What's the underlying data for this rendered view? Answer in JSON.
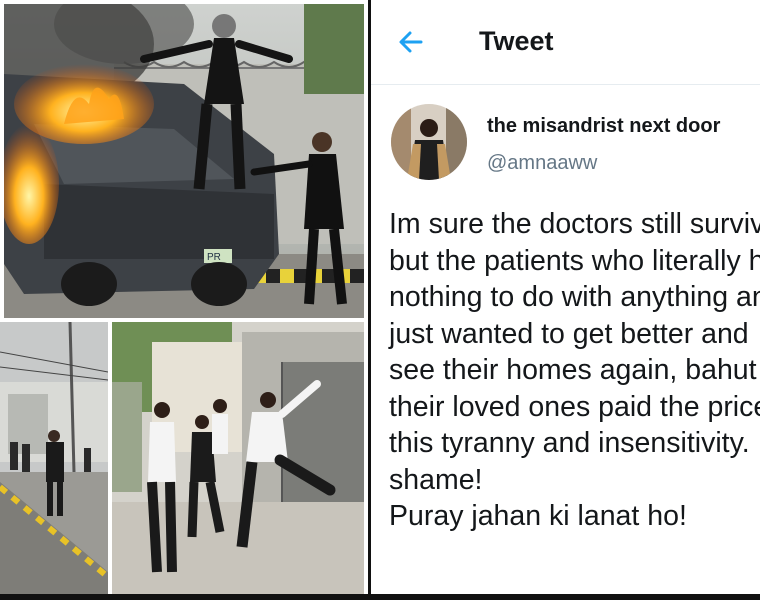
{
  "header": {
    "title": "Tweet"
  },
  "user": {
    "display_name": "the misandrist next door",
    "handle": "@amnaaww"
  },
  "tweet": {
    "lines": [
      "Im sure the doctors still survived",
      "but the patients who literally had",
      "nothing to do with anything and",
      "just wanted to get better and",
      "see their homes again, bahut sad",
      "their loved ones paid the price of",
      "this tyranny and insensitivity.",
      "shame!",
      "Puray jahan ki lanat ho!"
    ]
  },
  "photos": {
    "top": {
      "plate_text": "PR"
    }
  },
  "colors": {
    "accent": "#1da1f2",
    "text": "#14171a",
    "secondary": "#657786",
    "divider": "#e6ecf0"
  },
  "icons": {
    "back": "back-arrow-icon"
  }
}
